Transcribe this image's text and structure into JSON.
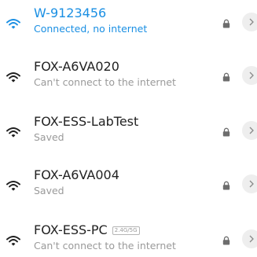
{
  "networks": [
    {
      "name": "W-9123456",
      "status": "Connected, no internet",
      "connected": true,
      "badge": "",
      "wifi_color": "#1a8fe3",
      "locked": true
    },
    {
      "name": "FOX-A6VA020",
      "status": "Can't connect to the internet",
      "connected": false,
      "badge": "",
      "wifi_color": "#1f1f1f",
      "locked": true
    },
    {
      "name": "FOX-ESS-LabTest",
      "status": "Saved",
      "connected": false,
      "badge": "",
      "wifi_color": "#1f1f1f",
      "locked": true
    },
    {
      "name": "FOX-A6VA004",
      "status": "Saved",
      "connected": false,
      "badge": "",
      "wifi_color": "#1f1f1f",
      "locked": true
    },
    {
      "name": "FOX-ESS-PC",
      "status": "Can't connect to the internet",
      "connected": false,
      "badge": "2.4G/5G",
      "wifi_color": "#1f1f1f",
      "locked": true
    }
  ],
  "icons": {
    "signal": "wifi-signal-icon",
    "lock": "lock-icon",
    "detail": "chevron-right-icon"
  },
  "colors": {
    "accent": "#1a8fe3",
    "primary_text": "#222222",
    "secondary_text": "#9a9a9a",
    "detail_bg": "#eeeeee"
  }
}
